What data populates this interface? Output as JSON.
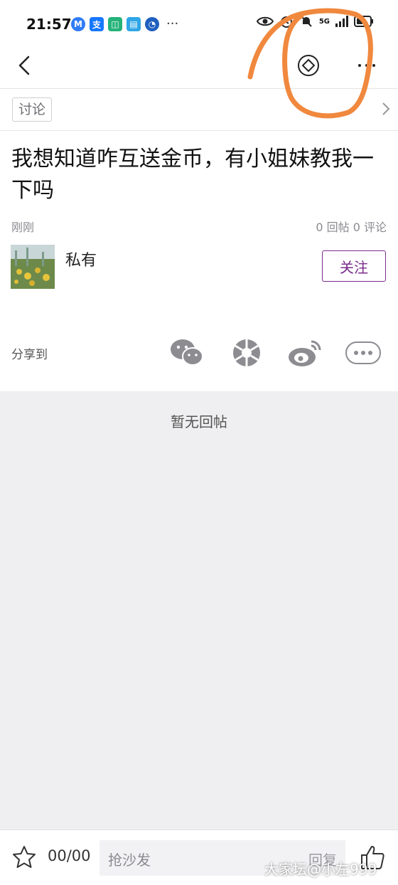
{
  "status_bar": {
    "time": "21:57",
    "notification_icons": [
      {
        "name": "mail-icon",
        "glyph": "M",
        "color": "#2f7cf6"
      },
      {
        "name": "alipay-icon",
        "glyph": "支",
        "color": "#1677ff"
      },
      {
        "name": "app-icon",
        "glyph": "◫",
        "color": "#25b37a"
      },
      {
        "name": "book-icon",
        "glyph": "▤",
        "color": "#2fa6e6"
      },
      {
        "name": "browser-icon",
        "glyph": "◔",
        "color": "#1f5fbf"
      }
    ],
    "more_notifications": "···",
    "network_label": "5G"
  },
  "nav": {},
  "tag": {
    "label": "讨论"
  },
  "post": {
    "title": "我想知道咋互送金币，有小姐妹教我一下吗",
    "time": "刚刚",
    "stats": "0 回帖 0 评论",
    "author": "私有",
    "follow_label": "关注"
  },
  "share": {
    "label": "分享到"
  },
  "replies": {
    "empty_text": "暂无回帖"
  },
  "bottom_bar": {
    "counter": "00/00",
    "reply_placeholder": "抢沙发",
    "reply_submit": "回复"
  },
  "watermark": "大家坛@小左999",
  "colors": {
    "accent": "#7a2c8c",
    "annotation": "#f0883e",
    "page_bg": "#efeff1"
  }
}
